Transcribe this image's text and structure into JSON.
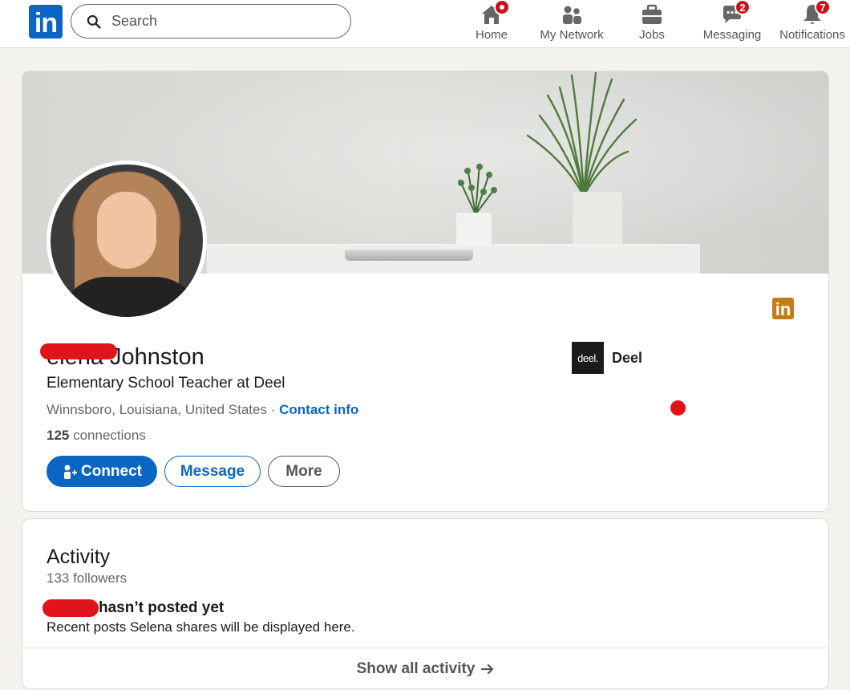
{
  "nav": {
    "logo_text": "in",
    "search_placeholder": "Search",
    "items": [
      {
        "label": "Home",
        "icon": "home-icon",
        "badge": ""
      },
      {
        "label": "My Network",
        "icon": "network-icon",
        "badge": ""
      },
      {
        "label": "Jobs",
        "icon": "briefcase-icon",
        "badge": ""
      },
      {
        "label": "Messaging",
        "icon": "chat-icon",
        "badge": "2"
      },
      {
        "label": "Notifications",
        "icon": "bell-icon",
        "badge": "7"
      }
    ]
  },
  "profile": {
    "name": "Selena Johnston",
    "name_visible": "elena Johnston",
    "headline": "Elementary School Teacher at Deel",
    "location": "Winnsboro, Louisiana, United States",
    "location_sep": " · ",
    "contact_info": "Contact info",
    "connections_count": "125",
    "connections_label": " connections",
    "company_logo_text": "deel.",
    "company_name": "Deel",
    "buttons": {
      "connect": "Connect",
      "message": "Message",
      "more": "More"
    }
  },
  "activity": {
    "title": "Activity",
    "followers": "133 followers",
    "empty_title": "hasn’t posted yet",
    "empty_desc": "Recent posts Selena shares will be displayed here.",
    "show_all": "Show all activity"
  },
  "colors": {
    "brand": "#0a66c2",
    "badge": "#cc1016",
    "redaction": "#e0121b",
    "premium_logo": "#c37d16"
  }
}
